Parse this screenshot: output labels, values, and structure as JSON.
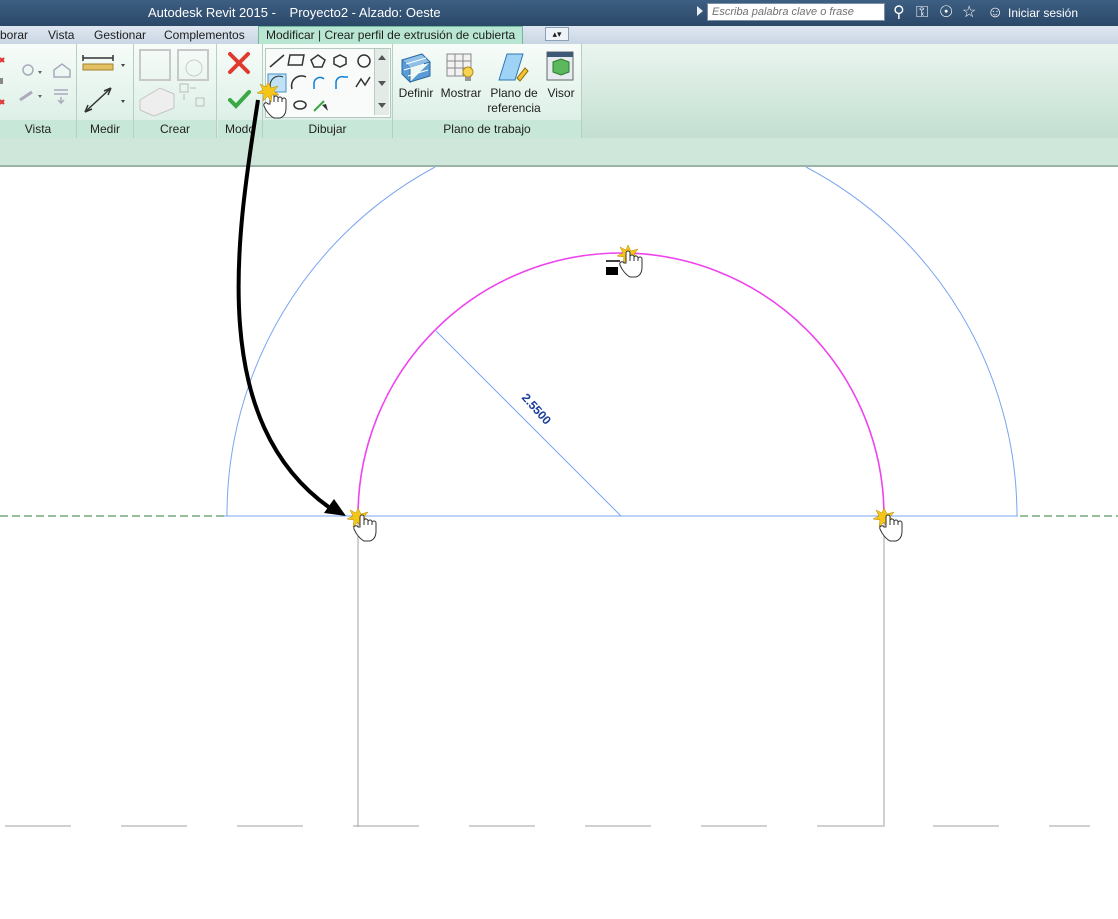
{
  "titlebar": {
    "app": "Autodesk Revit 2015 -",
    "project": "Proyecto2 - Alzado: Oeste",
    "search_placeholder": "Escriba palabra clave o frase",
    "signin_label": "Iniciar sesión",
    "icons": [
      "binoculars-icon",
      "key-icon",
      "satellite-icon",
      "star-icon",
      "user-icon"
    ]
  },
  "tabs": [
    {
      "label": "borar"
    },
    {
      "label": "Vista"
    },
    {
      "label": "Gestionar"
    },
    {
      "label": "Complementos"
    },
    {
      "label": "Modificar | Crear perfil de extrusión de cubierta",
      "active": true
    }
  ],
  "ribbon": {
    "panels": {
      "vista": "Vista",
      "medir": "Medir",
      "crear": "Crear",
      "modo": "Modo",
      "dibujar": "Dibujar",
      "plano": "Plano de trabajo"
    },
    "buttons": {
      "definir": "Definir",
      "mostrar": "Mostrar",
      "plano_ref": "Plano de\nreferencia",
      "visor": "Visor"
    }
  },
  "canvas": {
    "dimension_text": "2.5500",
    "colors": {
      "arc": "#ee44ee",
      "offset": "#7aa5f0",
      "dimension": "#1b3c9b",
      "level": "#2e7d32"
    }
  }
}
